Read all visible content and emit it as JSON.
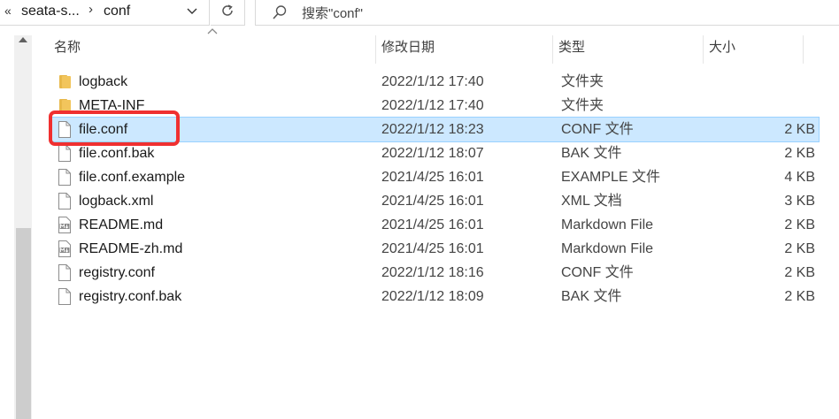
{
  "address": {
    "overflow_label": "«",
    "segments": [
      "seata-s...",
      "conf"
    ],
    "separator": "›"
  },
  "search": {
    "placeholder": "搜索\"conf\""
  },
  "columns": {
    "name": "名称",
    "date": "修改日期",
    "type": "类型",
    "size": "大小"
  },
  "files": [
    {
      "name": "logback",
      "date": "2022/1/12 17:40",
      "type": "文件夹",
      "size": "",
      "icon": "folder-icon"
    },
    {
      "name": "META-INF",
      "date": "2022/1/12 17:40",
      "type": "文件夹",
      "size": "",
      "icon": "folder-icon"
    },
    {
      "name": "file.conf",
      "date": "2022/1/12 18:23",
      "type": "CONF 文件",
      "size": "2 KB",
      "icon": "file-icon",
      "selected": true
    },
    {
      "name": "file.conf.bak",
      "date": "2022/1/12 18:07",
      "type": "BAK 文件",
      "size": "2 KB",
      "icon": "file-icon"
    },
    {
      "name": "file.conf.example",
      "date": "2021/4/25 16:01",
      "type": "EXAMPLE 文件",
      "size": "4 KB",
      "icon": "file-icon"
    },
    {
      "name": "logback.xml",
      "date": "2021/4/25 16:01",
      "type": "XML 文档",
      "size": "3 KB",
      "icon": "file-icon"
    },
    {
      "name": "README.md",
      "date": "2021/4/25 16:01",
      "type": "Markdown File",
      "size": "2 KB",
      "icon": "markdown-file-icon"
    },
    {
      "name": "README-zh.md",
      "date": "2021/4/25 16:01",
      "type": "Markdown File",
      "size": "2 KB",
      "icon": "markdown-file-icon"
    },
    {
      "name": "registry.conf",
      "date": "2022/1/12 18:16",
      "type": "CONF 文件",
      "size": "2 KB",
      "icon": "file-icon"
    },
    {
      "name": "registry.conf.bak",
      "date": "2022/1/12 18:09",
      "type": "BAK 文件",
      "size": "2 KB",
      "icon": "file-icon"
    }
  ],
  "colors": {
    "selection": "#cce8ff",
    "highlight_box": "#f03030",
    "folder": "#f2c55c"
  }
}
